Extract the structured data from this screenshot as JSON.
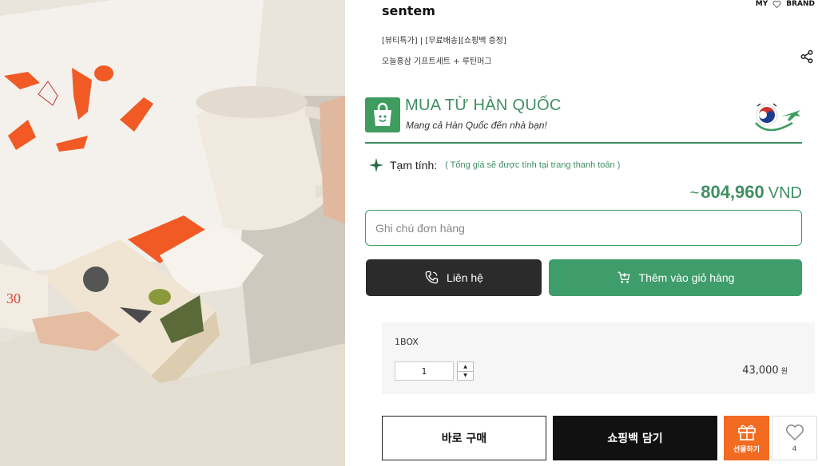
{
  "brand": "sentem",
  "nav": {
    "my": "MY",
    "brand": "BRAND"
  },
  "tags": "[뷰티특가] | [무료배송][쇼핑백 증정]",
  "subtitle": "오늘홍삼 기프트세트 + 루틴머그",
  "promo": {
    "title": "MUA TỪ HÀN QUỐC",
    "subtitle": "Mang cả Hàn Quốc đến nhà bạn!"
  },
  "estimate": {
    "label": "Tạm tính:",
    "note": "( Tổng giá sẽ được tính tại trang thanh toán )"
  },
  "price": {
    "approx": "~",
    "value": "804,960",
    "currency": "VND"
  },
  "note_input": {
    "placeholder": "Ghi chú đơn hàng"
  },
  "buttons": {
    "contact": "Liên hệ",
    "add_cart": "Thêm vào giỏ hàng",
    "buy_now": "바로 구매",
    "add_bag": "쇼핑백 담기",
    "gift": "선물하기",
    "wish_count": "4"
  },
  "option": {
    "name": "1BOX",
    "quantity": "1",
    "price": "43,000",
    "price_unit": "원"
  },
  "photo": {
    "box_number": "30"
  },
  "colors": {
    "accent_green": "#3f9c6b",
    "gift_orange": "#f36b21",
    "dark_button": "#2b2b2b"
  }
}
